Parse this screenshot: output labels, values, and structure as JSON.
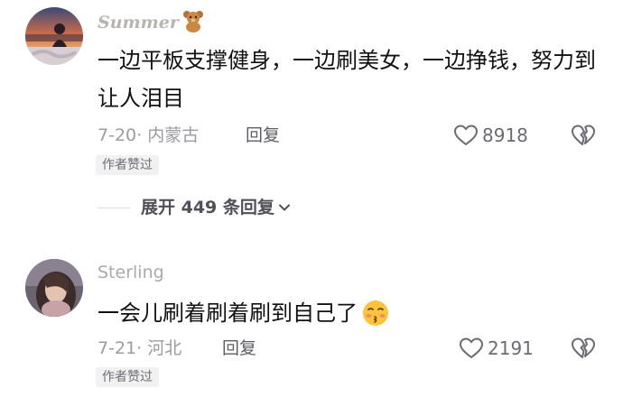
{
  "comments": [
    {
      "username": "Summer",
      "text": "一边平板支撑健身，一边刷美女，一边挣钱，努力到让人泪目",
      "date_location": "7-20· 内蒙古",
      "reply_label": "回复",
      "likes": "8918",
      "badge": "作者赞过",
      "icons": [
        "teddy-bear-emoji",
        "heart-outline-icon",
        "broken-heart-icon"
      ]
    },
    {
      "username": "Sterling",
      "text": "一会儿刷着刷着刷到自己了",
      "date_location": "7-21· 河北",
      "reply_label": "回复",
      "likes": "2191",
      "badge": "作者赞过",
      "icons": [
        "kissing-face-emoji",
        "heart-outline-icon",
        "broken-heart-icon"
      ]
    }
  ],
  "replies_toggle": {
    "label": "展开 449 条回复"
  },
  "colors": {
    "meta": "#9b9ba3",
    "text": "#111111",
    "badge_bg": "#f1f1f2"
  }
}
